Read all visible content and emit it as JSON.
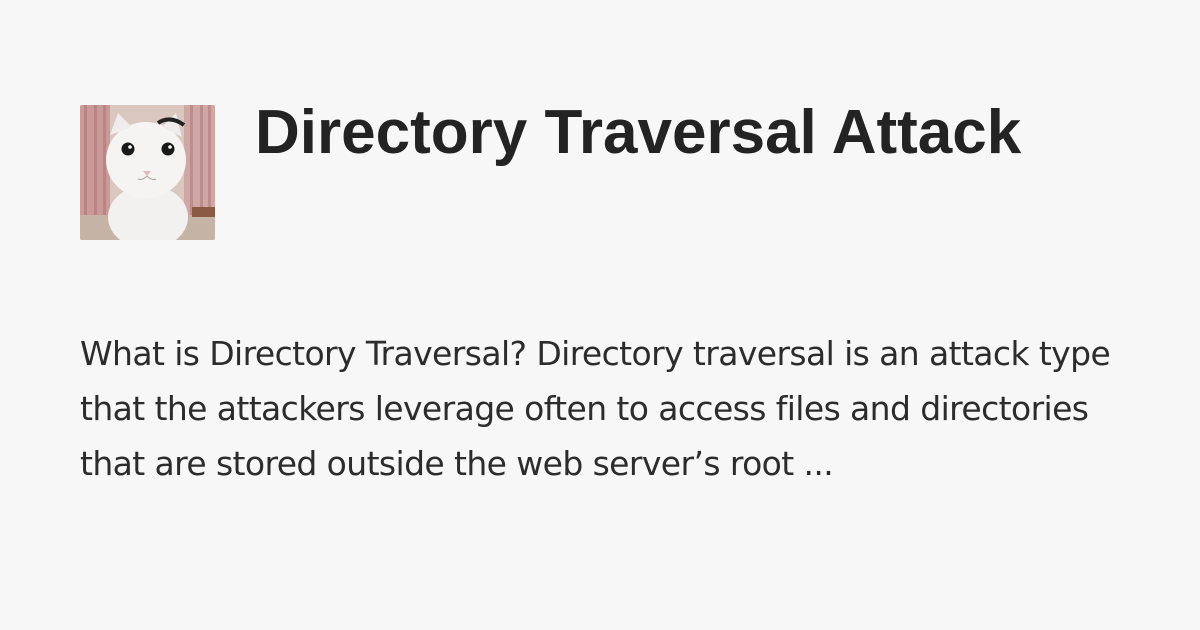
{
  "card": {
    "title": "Directory Traversal Attack",
    "description": "What is Directory Traversal? Directory traversal is an attack type that the attackers leverage often to access files and directories that are stored outside the web server’s root ...",
    "thumbnail_icon": "white-cat-photo"
  },
  "colors": {
    "background": "#f8f7f8",
    "title": "#232323",
    "description": "#2c2c2c"
  }
}
